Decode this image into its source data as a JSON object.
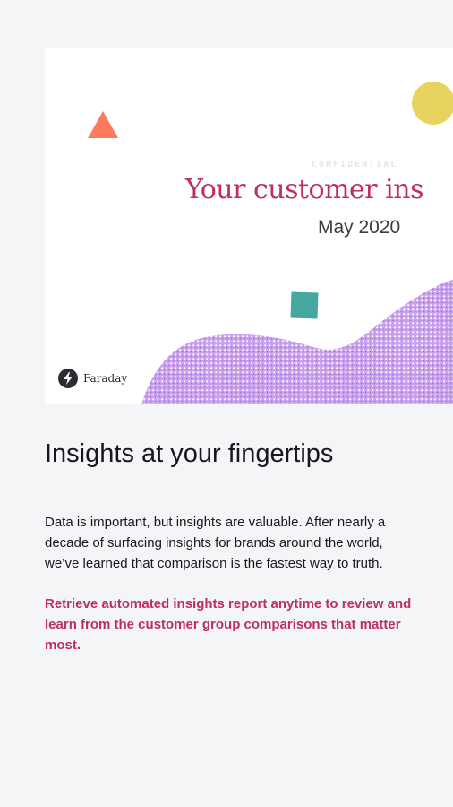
{
  "report_preview": {
    "confidential_label": "CONFIDENTIAL",
    "title": "Your customer ins",
    "date": "May 2020",
    "brand_name": "Faraday",
    "colors": {
      "title": "#be2d66",
      "triangle": "#fe7a5d",
      "circle": "#e8d35f",
      "square": "#46a6a0",
      "wave": "#b47be0"
    },
    "icons": [
      "triangle-shape",
      "circle-shape",
      "square-shape",
      "lightning-icon"
    ]
  },
  "section": {
    "heading": "Insights at your fingertips",
    "body": "Data is important, but insights are valuable. After nearly a decade of surfacing insights for brands around the world, we’ve learned that comparison is the fastest way to truth.",
    "highlight": "Retrieve automated insights report anytime to review and learn from the customer group comparisons that matter most."
  },
  "colors": {
    "page_background": "#f4f5f7",
    "text": "#17181b",
    "accent": "#be2d66"
  }
}
